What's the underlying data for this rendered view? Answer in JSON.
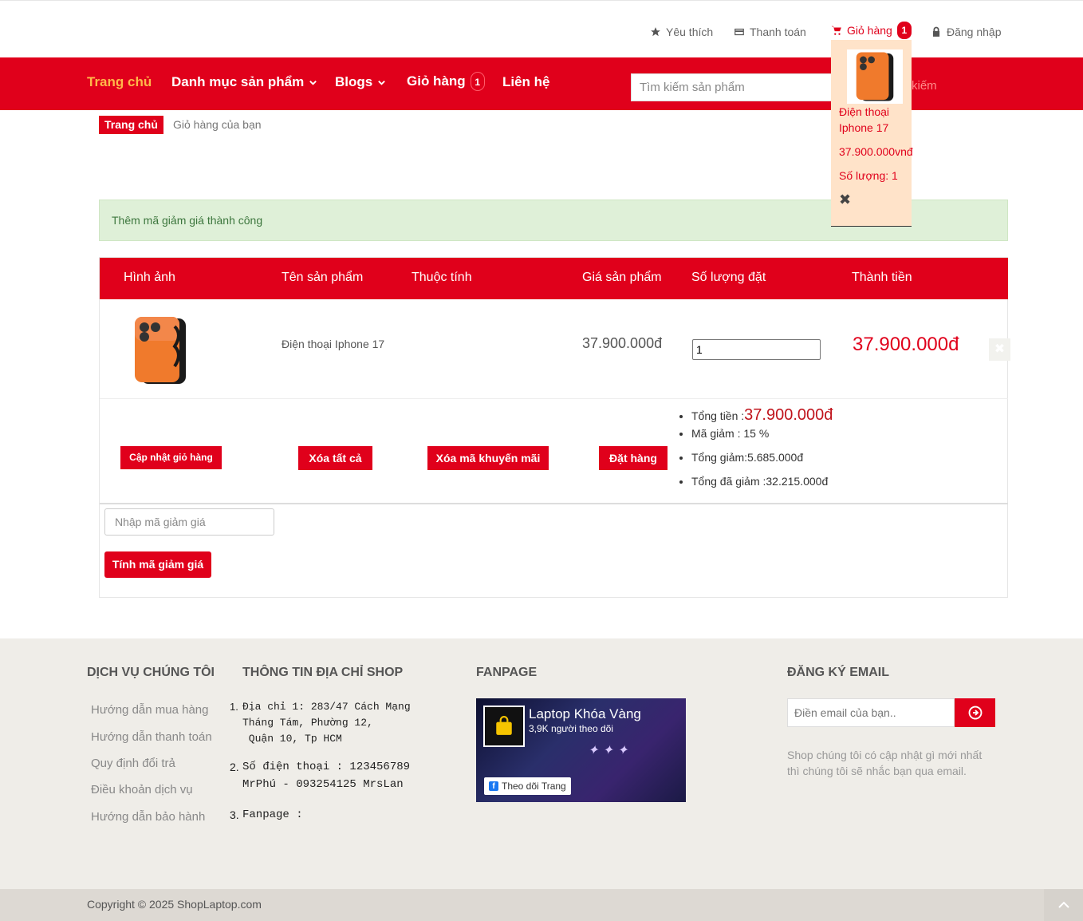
{
  "topbar": {
    "wishlist": "Yêu thích",
    "checkout": "Thanh toán",
    "cart": "Giỏ hàng",
    "cart_count": "1",
    "login": "Đăng nhập"
  },
  "nav": {
    "home": "Trang chủ",
    "categories": "Danh mục sản phẩm",
    "blogs": "Blogs",
    "cart": "Giỏ hàng",
    "cart_count": "1",
    "contact": "Liên hệ",
    "search_placeholder": "Tìm kiếm sản phẩm",
    "search_button": "kiếm"
  },
  "breadcrumb": {
    "home": "Trang chủ",
    "current": "Giỏ hàng của bạn"
  },
  "alert": "Thêm mã giảm giá thành công",
  "table": {
    "headers": [
      "Hình ảnh",
      "Tên sản phẩm",
      "Thuộc tính",
      "Giá sản phẩm",
      "Số lượng đặt",
      "Thành tiền"
    ],
    "rows": [
      {
        "name": "Điện thoại Iphone 17",
        "attributes": "",
        "price": "37.900.000đ",
        "quantity": "1",
        "subtotal": "37.900.000đ"
      }
    ]
  },
  "actions": {
    "update_cart": "Cập nhật giỏ hàng",
    "clear_all": "Xóa tất cả",
    "remove_coupon": "Xóa mã khuyến mãi",
    "order": "Đặt hàng"
  },
  "summary": {
    "total_label": "Tổng tiền :",
    "total_value": "37.900.000đ",
    "discount": "Mã giảm : 15 %",
    "total_discount": "Tổng giảm:5.685.000đ",
    "after_discount": "Tổng đã giảm :32.215.000đ"
  },
  "coupon": {
    "placeholder": "Nhập mã giảm giá",
    "button": "Tính mã giảm giá"
  },
  "dropdown": {
    "name": "Điện thoại Iphone 17",
    "price": "37.900.000vnđ",
    "qty": "Số lượng: 1"
  },
  "footer": {
    "services_title": "DỊCH VỤ CHÚNG TÔI",
    "services": [
      "Hướng dẫn mua hàng",
      "Hướng dẫn thanh toán",
      "Quy định đổi trả",
      "Điều khoản dịch vụ",
      "Hướng dẫn bảo hành"
    ],
    "shop_title": "THÔNG TIN ĐỊA CHỈ SHOP",
    "addr_1a": "Địa chỉ 1: 283/47 Cách Mạng",
    "addr_1b": "Tháng Tám, Phường 12,",
    "addr_1c": " Quận 10, Tp HCM",
    "addr_2a": "Số điện thoại : 123456789",
    "addr_2b": "MrPhú - 093254125 MrsLan",
    "addr_3": "Fanpage :",
    "fanpage_title": "FANPAGE",
    "fanpage_name": "Laptop Khóa Vàng",
    "fanpage_followers": "3,9K người theo dõi",
    "fanpage_follow": "Theo dõi Trang",
    "email_title": "ĐĂNG KÝ EMAIL",
    "email_placeholder": "Điền email của bạn..",
    "email_note_1": "Shop chúng tôi có cập nhật gì mới nhất",
    "email_note_2": "thì chúng tôi sẽ nhắc bạn qua email.",
    "copyright": "Copyright © 2025 ShopLaptop.com"
  }
}
